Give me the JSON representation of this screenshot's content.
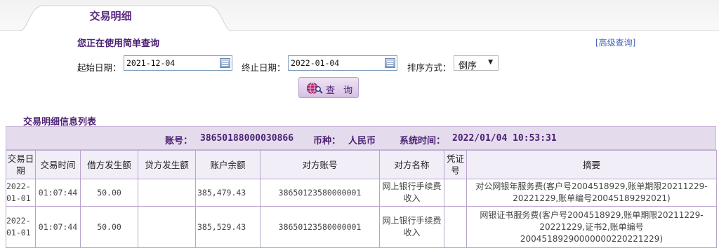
{
  "tab": {
    "title": "交易明细"
  },
  "query": {
    "mode_text": "您正在使用简单查询",
    "advanced_link": "[高级查询]",
    "start_label": "起始日期：",
    "start_value": "2021-12-04",
    "end_label": "终止日期：",
    "end_value": "2022-01-04",
    "sort_label": "排序方式：",
    "sort_value": "倒序",
    "query_button": "查 询"
  },
  "list": {
    "title": "交易明细信息列表",
    "info": {
      "account_label": "账号：",
      "account": "38650188000030866",
      "currency_label": "币种：",
      "currency": "人民币",
      "time_label": "系统时间：",
      "time": "2022/01/04 10:53:31"
    },
    "columns": [
      "交易日期",
      "交易时间",
      "借方发生额",
      "贷方发生额",
      "账户余额",
      "对方账号",
      "对方名称",
      "凭证号",
      "摘要"
    ],
    "rows": [
      {
        "date": "2022-01-01",
        "time": "01:07:44",
        "debit": "50.00",
        "credit": "",
        "balance": "385,479.43",
        "counter_account": "38650123580000001",
        "counter_name": "网上银行手续费收入",
        "voucher": "",
        "summary": "对公网银年服务费(客户号2004518929,账单期限20211229-20221229,账单编号20045189292021)"
      },
      {
        "date": "2022-01-01",
        "time": "01:07:44",
        "debit": "50.00",
        "credit": "",
        "balance": "385,529.43",
        "counter_account": "38650123580000001",
        "counter_name": "网上银行手续费收入",
        "voucher": "",
        "summary": "网银证书服务费(客户号2004518929,账单期限20211229-20221229,证书2,账单编号20045189290000000220221229)"
      }
    ]
  }
}
